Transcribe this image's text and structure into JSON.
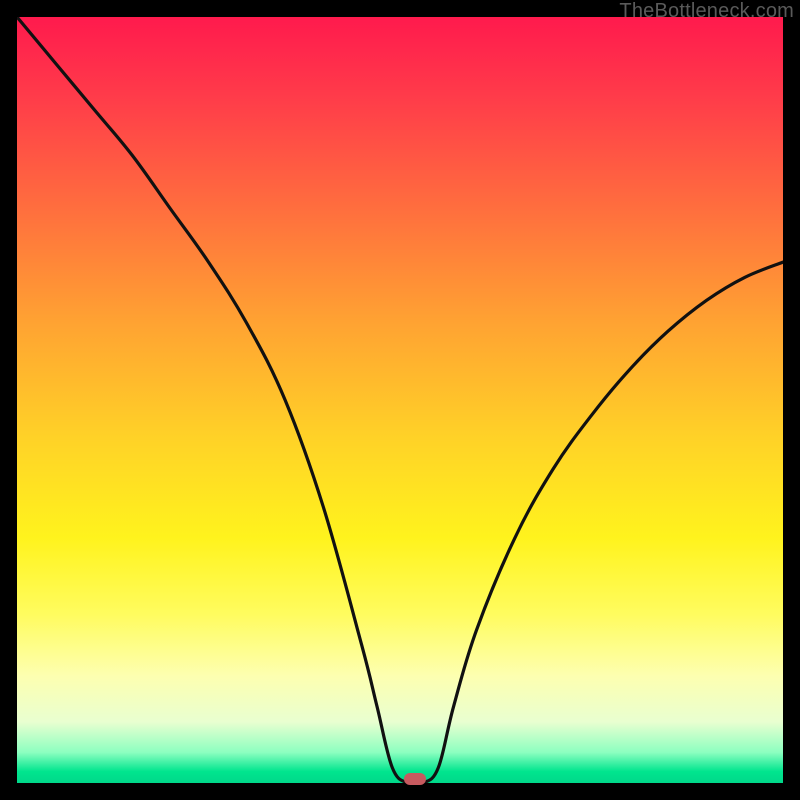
{
  "watermark": "TheBottleneck.com",
  "chart_data": {
    "type": "line",
    "title": "",
    "xlabel": "",
    "ylabel": "",
    "xlim": [
      0,
      100
    ],
    "ylim": [
      0,
      100
    ],
    "grid": false,
    "legend": false,
    "series": [
      {
        "name": "curve",
        "x": [
          0,
          5,
          10,
          15,
          20,
          25,
          30,
          35,
          40,
          45,
          47,
          49,
          51,
          53,
          55,
          57,
          60,
          65,
          70,
          75,
          80,
          85,
          90,
          95,
          100
        ],
        "values": [
          100,
          94,
          88,
          82,
          75,
          68,
          60,
          50,
          36,
          18,
          10,
          2,
          0,
          0,
          2,
          10,
          20,
          32,
          41,
          48,
          54,
          59,
          63,
          66,
          68
        ]
      }
    ],
    "marker": {
      "x": 52,
      "y": 0.5
    },
    "colors": {
      "curve": "#111111",
      "marker": "#c75a5f",
      "gradient_top": "#ff1a4d",
      "gradient_bottom": "#00d88a"
    }
  }
}
